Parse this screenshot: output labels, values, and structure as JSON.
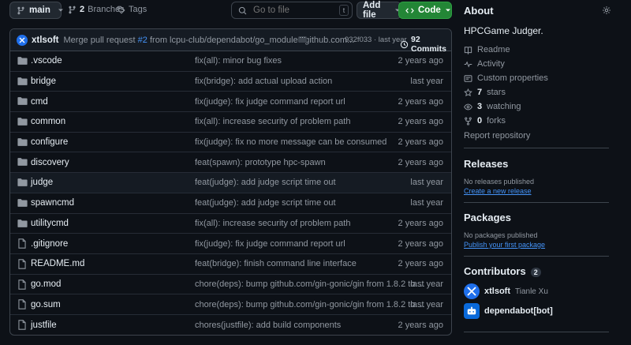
{
  "toolbar": {
    "branch": "main",
    "branches_count": "2",
    "branches_label": "Branches",
    "tags_label": "Tags",
    "goto_placeholder": "Go to file",
    "goto_shortcut": "t",
    "add_file_label": "Add file",
    "code_label": "Code"
  },
  "latest_commit": {
    "author": "xtlsoft",
    "message_prefix": "Merge pull request ",
    "pr": "#2",
    "message_suffix": " from lcpu-club/dependabot/go_modules/github.com...",
    "hash": "932f033",
    "separator": " · ",
    "age": "last year",
    "commits_count": "92 Commits"
  },
  "files": [
    {
      "type": "dir",
      "name": ".vscode",
      "message": "fix(all): minor bug fixes",
      "age": "2 years ago"
    },
    {
      "type": "dir",
      "name": "bridge",
      "message": "fix(bridge): add actual upload action",
      "age": "last year"
    },
    {
      "type": "dir",
      "name": "cmd",
      "message": "fix(judge): fix judge command report url",
      "age": "2 years ago"
    },
    {
      "type": "dir",
      "name": "common",
      "message": "fix(all): increase security of problem path",
      "age": "2 years ago"
    },
    {
      "type": "dir",
      "name": "configure",
      "message": "fix(judge): fix no more message can be consumed",
      "age": "2 years ago"
    },
    {
      "type": "dir",
      "name": "discovery",
      "message": "feat(spawn): prototype hpc-spawn",
      "age": "2 years ago"
    },
    {
      "type": "dir",
      "name": "judge",
      "message": "feat(judge): add judge script time out",
      "age": "last year"
    },
    {
      "type": "dir",
      "name": "spawncmd",
      "message": "feat(judge): add judge script time out",
      "age": "last year"
    },
    {
      "type": "dir",
      "name": "utilitycmd",
      "message": "fix(all): increase security of problem path",
      "age": "2 years ago"
    },
    {
      "type": "file",
      "name": ".gitignore",
      "message": "fix(judge): fix judge command report url",
      "age": "2 years ago"
    },
    {
      "type": "file",
      "name": "README.md",
      "message": "feat(bridge): finish command line interface",
      "age": "2 years ago"
    },
    {
      "type": "file",
      "name": "go.mod",
      "message": "chore(deps): bump github.com/gin-gonic/gin from 1.8.2 to ...",
      "age": "last year"
    },
    {
      "type": "file",
      "name": "go.sum",
      "message": "chore(deps): bump github.com/gin-gonic/gin from 1.8.2 to ...",
      "age": "last year"
    },
    {
      "type": "file",
      "name": "justfile",
      "message": "chores(justfile): add build components",
      "age": "2 years ago"
    }
  ],
  "about": {
    "title": "About",
    "description": "HPCGame Judger.",
    "readme": "Readme",
    "activity": "Activity",
    "custom_properties": "Custom properties",
    "stars_count": "7",
    "stars_label": "stars",
    "watching_count": "3",
    "watching_label": "watching",
    "forks_count": "0",
    "forks_label": "forks",
    "report": "Report repository"
  },
  "releases": {
    "title": "Releases",
    "empty": "No releases published",
    "action": "Create a new release"
  },
  "packages": {
    "title": "Packages",
    "empty": "No packages published",
    "action": "Publish your first package"
  },
  "contributors": {
    "title": "Contributors",
    "count": "2",
    "items": [
      {
        "login": "xtlsoft",
        "name": "Tianle Xu"
      },
      {
        "login": "dependabot[bot]",
        "name": ""
      }
    ]
  },
  "colors": {
    "background": "#0d1117",
    "accent_blue": "#4493f8",
    "code_green": "#238636",
    "folder": "#54aeff"
  }
}
